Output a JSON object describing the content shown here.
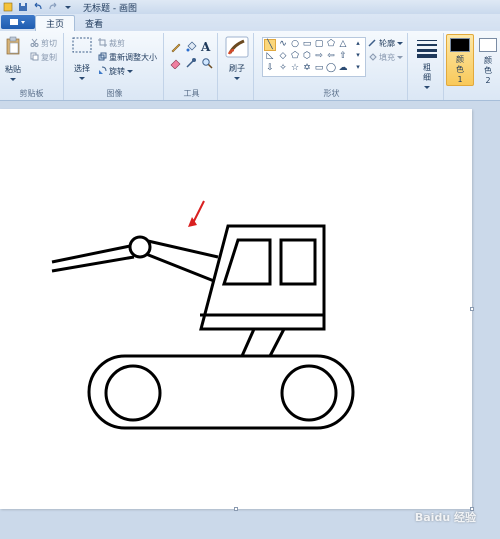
{
  "window": {
    "title": "无标题 - 画图"
  },
  "tabs": [
    {
      "label": "主页"
    },
    {
      "label": "查看"
    }
  ],
  "clipboard": {
    "paste": "粘贴",
    "cut": "剪切",
    "copy": "复制",
    "group": "剪贴板"
  },
  "image": {
    "select": "选择",
    "crop": "裁剪",
    "resize": "重新调整大小",
    "rotate": "旋转",
    "group": "图像"
  },
  "tools": {
    "group": "工具"
  },
  "brushes": {
    "label": "刷子"
  },
  "shapes": {
    "outline": "轮廓",
    "fill": "填充",
    "group": "形状"
  },
  "size": {
    "label": "粗细"
  },
  "colors": {
    "color1": "颜色 1",
    "color2": "颜色 2",
    "color1_value": "#000000",
    "color2_value": "#ffffff"
  },
  "watermark": "Baidu 经验"
}
